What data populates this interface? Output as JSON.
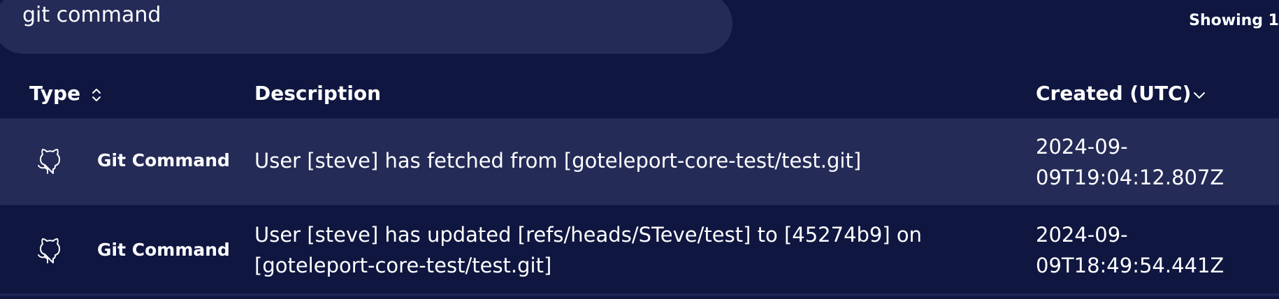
{
  "search": {
    "value": "git command"
  },
  "results": {
    "showing_text": "Showing 1"
  },
  "table": {
    "columns": {
      "type": "Type",
      "description": "Description",
      "created": "Created (UTC)"
    },
    "rows": [
      {
        "icon": "github-icon",
        "type": "Git Command",
        "description": "User [steve] has fetched from [goteleport-core-test/test.git]",
        "created": "2024-09-09T19:04:12.807Z"
      },
      {
        "icon": "github-icon",
        "type": "Git Command",
        "description": "User [steve] has updated [refs/heads/STeve/test] to [45274b9] on [goteleport-core-test/test.git]",
        "created": "2024-09-09T18:49:54.441Z"
      }
    ]
  },
  "colors": {
    "background": "#0f1640",
    "row_highlight": "#242b57",
    "search_bg": "#242b57",
    "text": "#ffffff"
  }
}
